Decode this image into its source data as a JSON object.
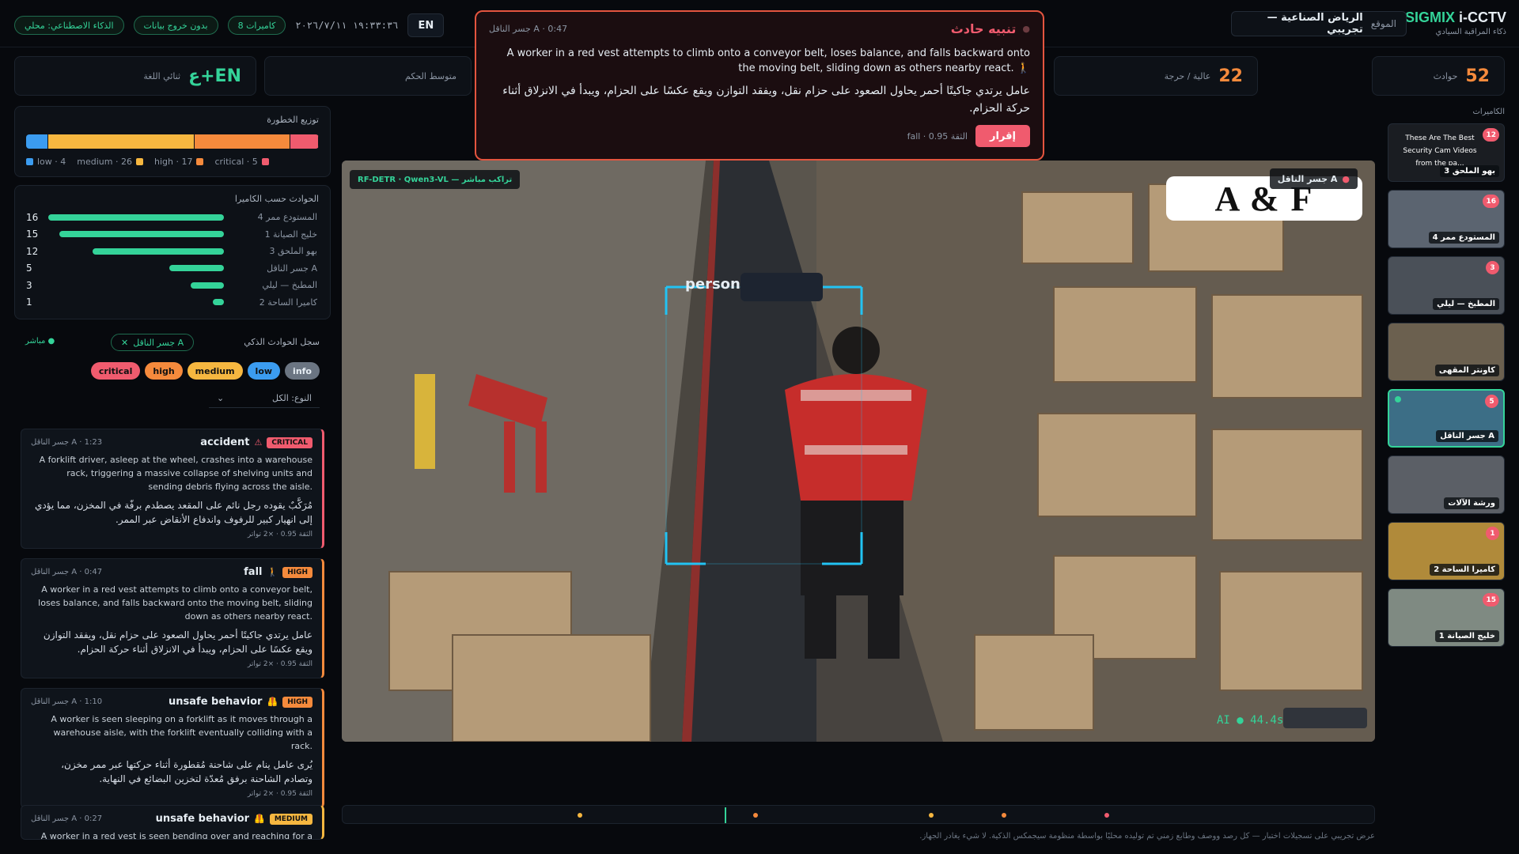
{
  "brand": {
    "prefix": "SIGMIX",
    "suffix": "i-CCTV",
    "subtitle": "ذكاء المراقبة السيادي"
  },
  "site": {
    "label": "الموقع",
    "value": "الرياض الصناعية — تجريبي"
  },
  "lang_toggle": "EN",
  "datetime": "١٩:٣٣:٣٦ ٢٠٢٦/٧/١١",
  "status_pills": [
    "8 كاميرات",
    "بدون خروج بيانات",
    "الذكاء الاصطناعي: محلي"
  ],
  "stats": {
    "incidents": {
      "value": "52",
      "label": "حوادث"
    },
    "high_critical": {
      "value": "22",
      "label": "عالية / حرجة"
    },
    "avg_conf": {
      "label": "متوسط الحكم"
    },
    "bilingual": {
      "value": "ع+EN",
      "label": "ثنائي اللغة"
    }
  },
  "risk": {
    "title": "توزيع الخطورة",
    "levels": [
      {
        "name": "low",
        "count": 4,
        "color": "#3b9cf0"
      },
      {
        "name": "medium",
        "count": 26,
        "color": "#f6b740"
      },
      {
        "name": "high",
        "count": 17,
        "color": "#f58a3c"
      },
      {
        "name": "critical",
        "count": 5,
        "color": "#f05b6e"
      }
    ],
    "legend": [
      "low · 4",
      "medium · 26",
      "high · 17",
      "critical · 5"
    ]
  },
  "by_camera": {
    "title": "الحوادث حسب الكاميرا",
    "max": 16,
    "rows": [
      {
        "name": "المستودع ممر 4",
        "count": 16
      },
      {
        "name": "خليج الصيانة 1",
        "count": 15
      },
      {
        "name": "بهو الملحق 3",
        "count": 12
      },
      {
        "name": "جسر الناقل A",
        "count": 5
      },
      {
        "name": "المطبخ — ليلي",
        "count": 3
      },
      {
        "name": "كاميرا الساحة 2",
        "count": 1
      }
    ]
  },
  "log": {
    "title": "سجل الحوادث الذكي",
    "camera_chip": "جسر الناقل A",
    "live": "مباشر",
    "filters": [
      "critical",
      "high",
      "medium",
      "low",
      "info"
    ],
    "type_select": "النوع: الكل",
    "cards": [
      {
        "meta": "جسر الناقل A · 1:23",
        "title": "accident",
        "icon": "⚠",
        "badge": "CRITICAL",
        "color": "#f05b6e",
        "en": "A forklift driver, asleep at the wheel, crashes into a warehouse rack, triggering a massive collapse of shelving units and sending debris flying across the aisle.",
        "ar": "مُرَكَّبٌ يقوده رجل نائم على المقعد يصطدم برفّة في المخزن، مما يؤدي إلى انهيار كبير للرفوف واندفاع الأنقاض عبر الممر.",
        "foot": "الثقة 0.95 · ×2 تواتر"
      },
      {
        "meta": "جسر الناقل A · 0:47",
        "title": "fall",
        "icon": "🚶",
        "badge": "HIGH",
        "color": "#f58a3c",
        "en": "A worker in a red vest attempts to climb onto a conveyor belt, loses balance, and falls backward onto the moving belt, sliding down as others nearby react.",
        "ar": "عامل يرتدي جاكيتًا أحمر يحاول الصعود على حزام نقل، ويفقد التوازن ويقع عكسًا على الحزام، ويبدأ في الانزلاق أثناء حركة الحزام.",
        "foot": "الثقة 0.95 · ×2 تواتر"
      },
      {
        "meta": "جسر الناقل A · 1:10",
        "title": "unsafe behavior",
        "icon": "🦺",
        "badge": "HIGH",
        "color": "#f58a3c",
        "en": "A worker is seen sleeping on a forklift as it moves through a warehouse aisle, with the forklift eventually colliding with a rack.",
        "ar": "يُرى عامل ينام على شاحنة مُقطورة أثناء حركتها عبر ممر مخزن، وتصادم الشاحنة برفق مُعدّة لتخزين البضائع في النهاية.",
        "foot": "الثقة 0.95 · ×2 تواتر"
      },
      {
        "meta": "جسر الناقل A · 0:27",
        "title": "unsafe behavior",
        "icon": "🦺",
        "badge": "MEDIUM",
        "color": "#f6b740",
        "en": "A worker in a red vest is seen bending over and reaching for a box on the conveyor belt, which is not a standard or safe procedure for",
        "ar": "",
        "foot": ""
      }
    ]
  },
  "alert": {
    "title": "تنبيه حادث",
    "meta": "جسر الناقل A · 0:47",
    "en": "A worker in a red vest attempts to climb onto a conveyor belt, loses balance, and falls backward onto the moving belt, sliding down as others nearby react.",
    "ar": "عامل يرتدي جاكيتًا أحمر يحاول الصعود على حزام نقل، ويفقد التوازن ويقع عكسًا على الحزام، ويبدأ في الانزلاق أثناء حركة الحزام.",
    "confidence": "fall · 0.95 الثقة",
    "ack": "إقرار"
  },
  "video": {
    "model_tag": "RF-DETR · Qwen3-VL — تراكب مباشر",
    "camera_tag": "جسر الناقل A",
    "watermark": "A & F",
    "detection_label": "person",
    "ai_readout": "AI ● 44.4s"
  },
  "cameras": {
    "title": "الكاميرات",
    "items": [
      {
        "name": "بهو الملحق 3",
        "count": "12",
        "caption": "These Are The Best Security Cam Videos from the pa..."
      },
      {
        "name": "المستودع ممر 4",
        "count": "16"
      },
      {
        "name": "المطبخ — ليلي",
        "count": "3"
      },
      {
        "name": "كاونتر المقهى",
        "count": ""
      },
      {
        "name": "جسر الناقل A",
        "count": "5",
        "active": true
      },
      {
        "name": "ورشة الآلات",
        "count": ""
      },
      {
        "name": "كاميرا الساحة 2",
        "count": "1"
      },
      {
        "name": "خليج الصيانة 1",
        "count": "15"
      }
    ]
  },
  "timeline": {
    "events": [
      {
        "pos": 0.23,
        "color": "#f6b740"
      },
      {
        "pos": 0.4,
        "color": "#f58a3c"
      },
      {
        "pos": 0.57,
        "color": "#f6b740"
      },
      {
        "pos": 0.64,
        "color": "#f58a3c"
      },
      {
        "pos": 0.74,
        "color": "#f05b6e"
      }
    ],
    "playhead": 0.37
  },
  "disclaimer": "عرض تجريبي على تسجيلات اختبار — كل رصد ووصف وطابع زمني تم توليده محليًا بواسطة منظومة سيجمكس الذكية. لا شيء يغادر الجهاز."
}
